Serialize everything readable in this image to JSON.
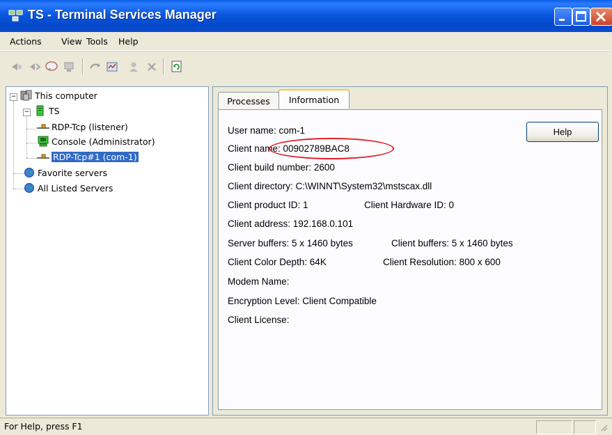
{
  "window": {
    "title": "TS - Terminal Services Manager",
    "minimize_icon": "minimize-icon",
    "maximize_icon": "maximize-icon",
    "close_icon": "close-icon"
  },
  "menu": {
    "items": [
      "Actions",
      "View",
      "Tools",
      "Help"
    ]
  },
  "toolbar": {
    "icons": [
      "send-message-icon",
      "connect-icon",
      "message-icon",
      "disconnect-icon",
      "reset-icon",
      "status-icon",
      "logoff-icon",
      "end-process-icon",
      "refresh-icon"
    ]
  },
  "tree": {
    "root": "This computer",
    "server": "TS",
    "sessions": [
      "RDP-Tcp (listener)",
      "Console (Administrator)",
      "RDP-Tcp#1 (com-1)"
    ],
    "favorites": "Favorite servers",
    "all_servers": "All Listed Servers"
  },
  "tabs": [
    "Processes",
    "Information"
  ],
  "active_tab": "Information",
  "info": {
    "user_name": "User name: com-1",
    "client_name": "Client name:  00902789BAC8",
    "client_build": "Client build number:  2600",
    "client_directory": "Client directory:  C:\\WINNT\\System32\\mstscax.dll",
    "client_product_id": "Client product ID:   1",
    "client_hardware_id": "Client Hardware ID:   0",
    "client_address": "Client address: 192.168.0.101",
    "server_buffers": "Server buffers: 5 x 1460 bytes",
    "client_buffers": "Client buffers:  5 x 1460 bytes",
    "color_depth": "Client Color Depth:  64K",
    "resolution": "Client Resolution:   800 x 600",
    "modem_name": "Modem Name:",
    "encryption": "Encryption Level:  Client Compatible",
    "license": "Client License:"
  },
  "help_button": "Help",
  "highlight_color": "#e0202a",
  "selection_color": "#316ac5",
  "status": {
    "text": "For Help, press F1"
  }
}
